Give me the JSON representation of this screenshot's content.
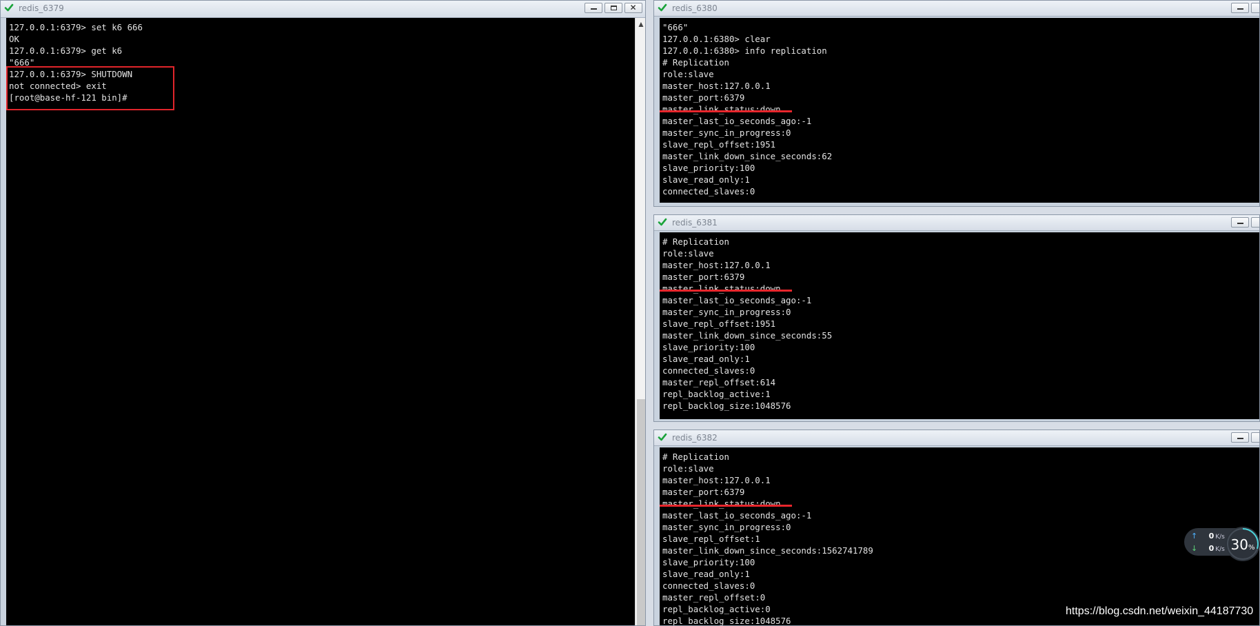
{
  "colors": {
    "terminal_bg": "#000000",
    "terminal_text": "#e3e3e3",
    "highlight": "#e1252b",
    "check": "#1aa33a"
  },
  "windows": [
    {
      "title": "redis_6379",
      "lines": [
        "127.0.0.1:6379> set k6 666",
        "OK",
        "127.0.0.1:6379> get k6",
        "\"666\"",
        "127.0.0.1:6379> SHUTDOWN",
        "not connected> exit",
        "[root@base-hf-121 bin]#"
      ]
    },
    {
      "title": "redis_6380",
      "lines": [
        "\"666\"",
        "127.0.0.1:6380> clear",
        "127.0.0.1:6380> info replication",
        "# Replication",
        "role:slave",
        "master_host:127.0.0.1",
        "master_port:6379",
        "master_link_status:down",
        "master_last_io_seconds_ago:-1",
        "master_sync_in_progress:0",
        "slave_repl_offset:1951",
        "master_link_down_since_seconds:62",
        "slave_priority:100",
        "slave_read_only:1",
        "connected_slaves:0"
      ]
    },
    {
      "title": "redis_6381",
      "lines": [
        "# Replication",
        "role:slave",
        "master_host:127.0.0.1",
        "master_port:6379",
        "master_link_status:down",
        "master_last_io_seconds_ago:-1",
        "master_sync_in_progress:0",
        "slave_repl_offset:1951",
        "master_link_down_since_seconds:55",
        "slave_priority:100",
        "slave_read_only:1",
        "connected_slaves:0",
        "master_repl_offset:614",
        "repl_backlog_active:1",
        "repl_backlog_size:1048576"
      ]
    },
    {
      "title": "redis_6382",
      "lines": [
        "# Replication",
        "role:slave",
        "master_host:127.0.0.1",
        "master_port:6379",
        "master_link_status:down",
        "master_last_io_seconds_ago:-1",
        "master_sync_in_progress:0",
        "slave_repl_offset:1",
        "master_link_down_since_seconds:1562741789",
        "slave_priority:100",
        "slave_read_only:1",
        "connected_slaves:0",
        "master_repl_offset:0",
        "repl_backlog_active:0",
        "repl_backlog_size:1048576"
      ]
    }
  ],
  "network_widget": {
    "upload_value": "0",
    "upload_unit": "K/s",
    "download_value": "0",
    "download_unit": "K/s",
    "usage_value": "30",
    "usage_unit": "%",
    "usage_fraction": 0.3
  },
  "watermark": "https://blog.csdn.net/weixin_44187730"
}
